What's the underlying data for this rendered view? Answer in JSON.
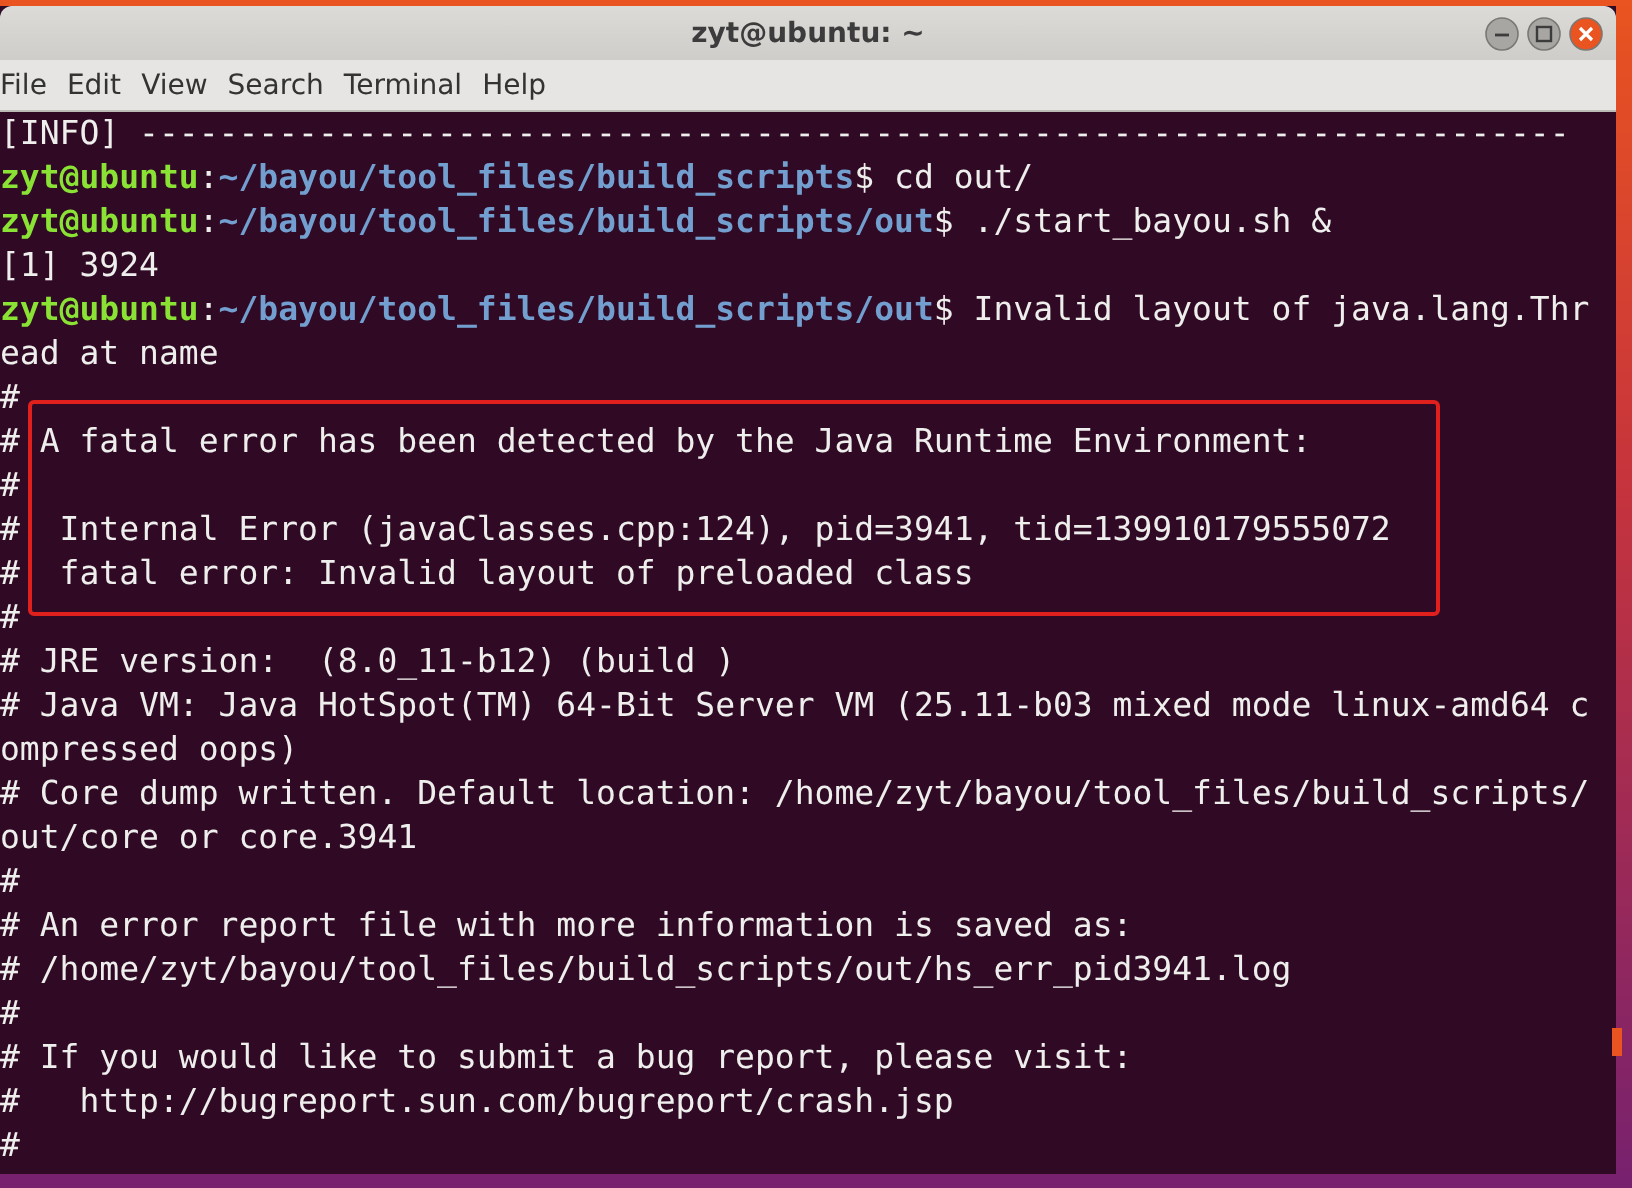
{
  "window": {
    "title": "zyt@ubuntu: ~"
  },
  "menu": [
    "File",
    "Edit",
    "View",
    "Search",
    "Terminal",
    "Help"
  ],
  "terminal": {
    "lines": [
      {
        "highlighted": false,
        "segments": [
          {
            "kind": "plain",
            "text": "[INFO] ------------------------------------------------------------------------"
          }
        ]
      },
      {
        "highlighted": false,
        "segments": [
          {
            "kind": "user",
            "text": "zyt@ubuntu"
          },
          {
            "kind": "plain",
            "text": ":"
          },
          {
            "kind": "path",
            "text": "~/bayou/tool_files/build_scripts"
          },
          {
            "kind": "plain",
            "text": "$ cd out/"
          }
        ]
      },
      {
        "highlighted": false,
        "segments": [
          {
            "kind": "user",
            "text": "zyt@ubuntu"
          },
          {
            "kind": "plain",
            "text": ":"
          },
          {
            "kind": "path",
            "text": "~/bayou/tool_files/build_scripts/out"
          },
          {
            "kind": "plain",
            "text": "$ ./start_bayou.sh &"
          }
        ]
      },
      {
        "highlighted": false,
        "segments": [
          {
            "kind": "plain",
            "text": "[1] 3924"
          }
        ]
      },
      {
        "highlighted": false,
        "segments": [
          {
            "kind": "user",
            "text": "zyt@ubuntu"
          },
          {
            "kind": "plain",
            "text": ":"
          },
          {
            "kind": "path",
            "text": "~/bayou/tool_files/build_scripts/out"
          },
          {
            "kind": "plain",
            "text": "$ Invalid layout of java.lang.Thr"
          }
        ]
      },
      {
        "highlighted": false,
        "segments": [
          {
            "kind": "plain",
            "text": "ead at name"
          }
        ]
      },
      {
        "highlighted": false,
        "segments": [
          {
            "kind": "plain",
            "text": "#"
          }
        ]
      },
      {
        "highlighted": true,
        "segments": [
          {
            "kind": "plain",
            "text": "# A fatal error has been detected by the Java Runtime Environment:"
          }
        ]
      },
      {
        "highlighted": true,
        "segments": [
          {
            "kind": "plain",
            "text": "#"
          }
        ]
      },
      {
        "highlighted": true,
        "segments": [
          {
            "kind": "plain",
            "text": "#  Internal Error (javaClasses.cpp:124), pid=3941, tid=139910179555072"
          }
        ]
      },
      {
        "highlighted": true,
        "segments": [
          {
            "kind": "plain",
            "text": "#  fatal error: Invalid layout of preloaded class"
          }
        ]
      },
      {
        "highlighted": false,
        "segments": [
          {
            "kind": "plain",
            "text": "#"
          }
        ]
      },
      {
        "highlighted": false,
        "segments": [
          {
            "kind": "plain",
            "text": "# JRE version:  (8.0_11-b12) (build )"
          }
        ]
      },
      {
        "highlighted": false,
        "segments": [
          {
            "kind": "plain",
            "text": "# Java VM: Java HotSpot(TM) 64-Bit Server VM (25.11-b03 mixed mode linux-amd64 c"
          }
        ]
      },
      {
        "highlighted": false,
        "segments": [
          {
            "kind": "plain",
            "text": "ompressed oops)"
          }
        ]
      },
      {
        "highlighted": false,
        "segments": [
          {
            "kind": "plain",
            "text": "# Core dump written. Default location: /home/zyt/bayou/tool_files/build_scripts/"
          }
        ]
      },
      {
        "highlighted": false,
        "segments": [
          {
            "kind": "plain",
            "text": "out/core or core.3941"
          }
        ]
      },
      {
        "highlighted": false,
        "segments": [
          {
            "kind": "plain",
            "text": "#"
          }
        ]
      },
      {
        "highlighted": false,
        "segments": [
          {
            "kind": "plain",
            "text": "# An error report file with more information is saved as:"
          }
        ]
      },
      {
        "highlighted": false,
        "segments": [
          {
            "kind": "plain",
            "text": "# /home/zyt/bayou/tool_files/build_scripts/out/hs_err_pid3941.log"
          }
        ]
      },
      {
        "highlighted": false,
        "segments": [
          {
            "kind": "plain",
            "text": "#"
          }
        ]
      },
      {
        "highlighted": false,
        "segments": [
          {
            "kind": "plain",
            "text": "# If you would like to submit a bug report, please visit:"
          }
        ]
      },
      {
        "highlighted": false,
        "segments": [
          {
            "kind": "plain",
            "text": "#   http://bugreport.sun.com/bugreport/crash.jsp"
          }
        ]
      },
      {
        "highlighted": false,
        "segments": [
          {
            "kind": "plain",
            "text": "#"
          }
        ]
      }
    ]
  }
}
